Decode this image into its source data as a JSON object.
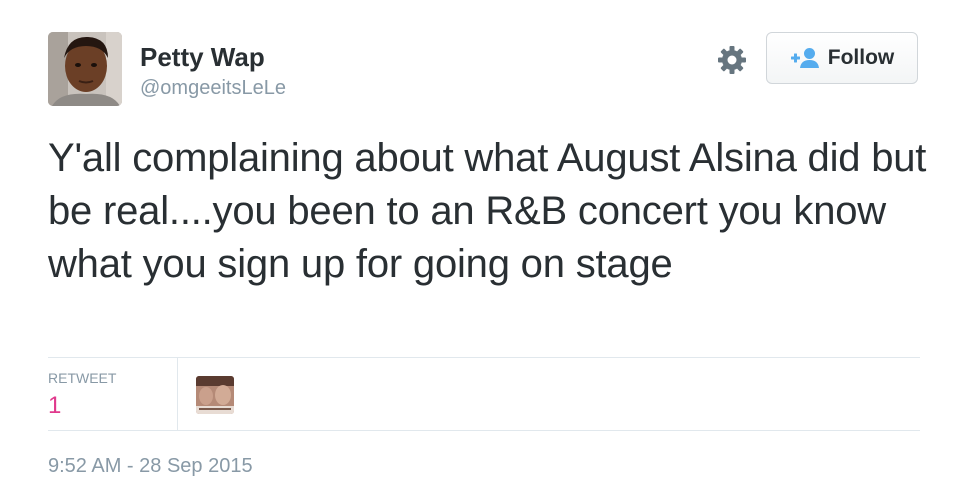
{
  "tweet": {
    "user": {
      "name": "Petty Wap",
      "handle": "@omgeeitsLeLe"
    },
    "follow_label": "Follow",
    "text": "Y'all complaining about what August Alsina did but be real....you been to an R&B concert you know what you sign up for going on stage",
    "stats": {
      "retweet_label": "RETWEET",
      "retweet_count": "1"
    },
    "timestamp": "9:52 AM - 28 Sep 2015"
  },
  "colors": {
    "text": "#292f33",
    "muted": "#8899a6",
    "accent_count": "#e0398c",
    "follow_icon": "#55acee",
    "divider": "#e1e8ed"
  },
  "icons": {
    "settings": "gear-icon",
    "follow": "follow-person-plus-icon"
  }
}
